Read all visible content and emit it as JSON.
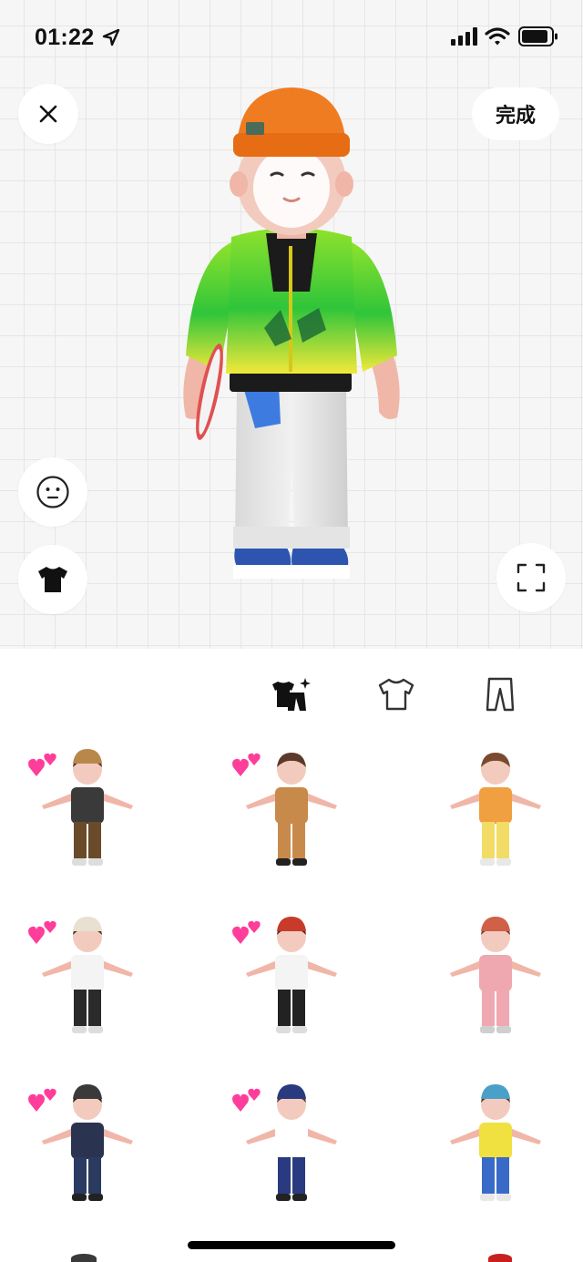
{
  "status_bar": {
    "time": "01:22",
    "icons": [
      "location-arrow-icon",
      "cellular-signal-icon",
      "wifi-icon",
      "battery-icon"
    ]
  },
  "top_bar": {
    "close_icon": "close-icon",
    "done_label": "完成"
  },
  "side_tools": {
    "face_icon": "face-icon",
    "outfit_icon": "tshirt-icon",
    "fullscreen_icon": "fullscreen-icon"
  },
  "category_tabs": [
    {
      "name": "outfit-sets",
      "icon": "outfit-set-sparkle-icon",
      "selected": true
    },
    {
      "name": "tops",
      "icon": "tshirt-outline-icon",
      "selected": false
    },
    {
      "name": "bottoms",
      "icon": "pants-outline-icon",
      "selected": false
    }
  ],
  "outfits": [
    {
      "favorite": true
    },
    {
      "favorite": true
    },
    {
      "favorite": false
    },
    {
      "favorite": true
    },
    {
      "favorite": true
    },
    {
      "favorite": false
    },
    {
      "favorite": true
    },
    {
      "favorite": true
    },
    {
      "favorite": false
    }
  ],
  "colors": {
    "favorite_heart": "#ff3d9a",
    "accent_text": "#111111",
    "beanie": "#f07c22",
    "hoodie_top": "#9ae830",
    "hoodie_bottom": "#f2e83a"
  }
}
